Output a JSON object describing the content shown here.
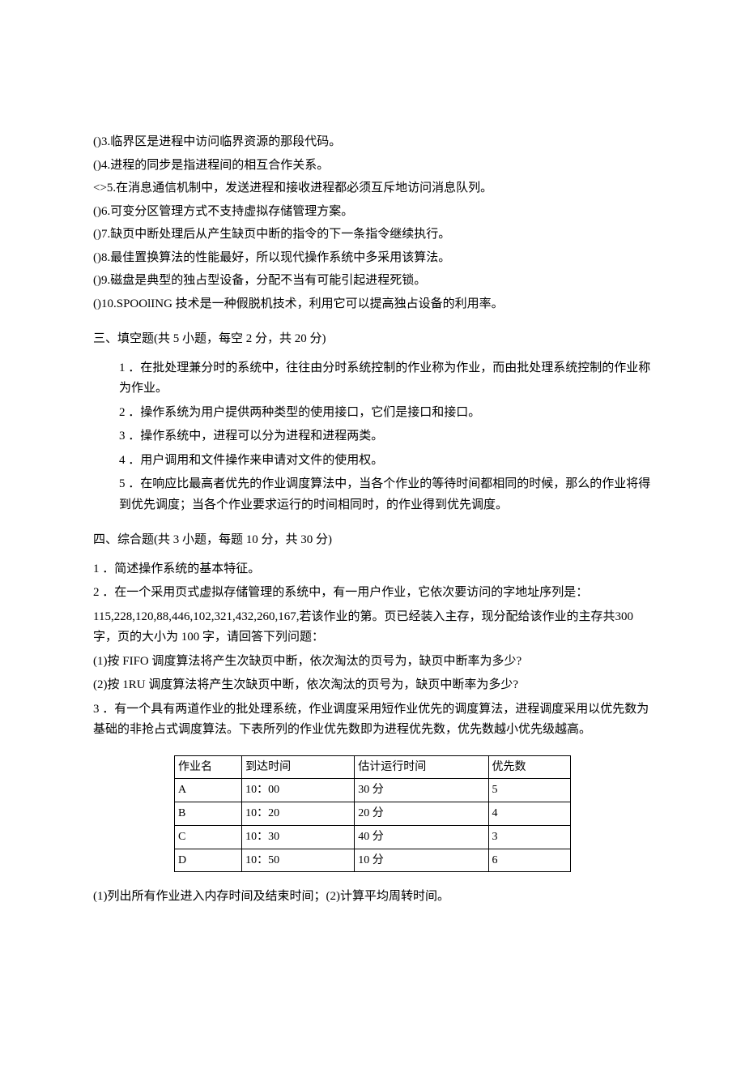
{
  "true_false": {
    "items": [
      "()3.临界区是进程中访问临界资源的那段代码。",
      "()4.进程的同步是指进程间的相互合作关系。",
      "<>5.在消息通信机制中，发送进程和接收进程都必须互斥地访问消息队列。",
      "()6.可变分区管理方式不支持虚拟存储管理方案。",
      "()7.缺页中断处理后从产生缺页中断的指令的下一条指令继续执行。",
      "()8.最佳置换算法的性能最好，所以现代操作系统中多采用该算法。",
      "()9.磁盘是典型的独占型设备，分配不当有可能引起进程死锁。",
      "()10.SPOOlING 技术是一种假脱机技术，利用它可以提高独占设备的利用率。"
    ]
  },
  "fill": {
    "heading": "三、填空题(共 5 小题，每空 2 分，共 20 分)",
    "items": [
      "1 ．在批处理兼分时的系统中，往往由分时系统控制的作业称为作业，而由批处理系统控制的作业称为作业。",
      "2 ．操作系统为用户提供两种类型的使用接口，它们是接口和接口。",
      "3 ．操作系统中，进程可以分为进程和进程两类。",
      "4 ．用户调用和文件操作来申请对文件的使用权。",
      "5 ．在响应比最高者优先的作业调度算法中，当各个作业的等待时间都相同的时候，那么的作业将得到优先调度；当各个作业要求运行的时间相同时，的作业得到优先调度。"
    ]
  },
  "comp": {
    "heading": "四、综合题(共 3 小题，每题 10 分，共 30 分)",
    "q1": "1 ．简述操作系统的基本特征。",
    "q2a": "2 ．在一个采用页式虚拟存储管理的系统中，有一用户作业，它依次要访问的字地址序列是：",
    "q2b": "115,228,120,88,446,102,321,432,260,167,若该作业的第。页已经装入主存，现分配给该作业的主存共300 字，页的大小为 100 字，请回答下列问题：",
    "q2c": "(1)按 FIFO 调度算法将产生次缺页中断，依次淘汰的页号为，缺页中断率为多少?",
    "q2d": "(2)按 1RU 调度算法将产生次缺页中断，依次淘汰的页号为，缺页中断率为多少?",
    "q3a": "3 ．有一个具有两道作业的批处理系统，作业调度采用短作业优先的调度算法，进程调度采用以优先数为基础的非抢占式调度算法。下表所列的作业优先数即为进程优先数，优先数越小优先级越高。",
    "q3b": "(1)列出所有作业进入内存时间及结束时间；(2)计算平均周转时间。"
  },
  "table": {
    "headers": [
      "作业名",
      "到达时间",
      "估计运行时间",
      "优先数"
    ],
    "rows": [
      {
        "name": "A",
        "arrive": "10：00",
        "est": "30 分",
        "pri": "5"
      },
      {
        "name": "B",
        "arrive": "10：20",
        "est": "20 分",
        "pri": "4"
      },
      {
        "name": "C",
        "arrive": "10：30",
        "est": "40 分",
        "pri": "3"
      },
      {
        "name": "D",
        "arrive": "10：50",
        "est": "10 分",
        "pri": "6"
      }
    ]
  }
}
